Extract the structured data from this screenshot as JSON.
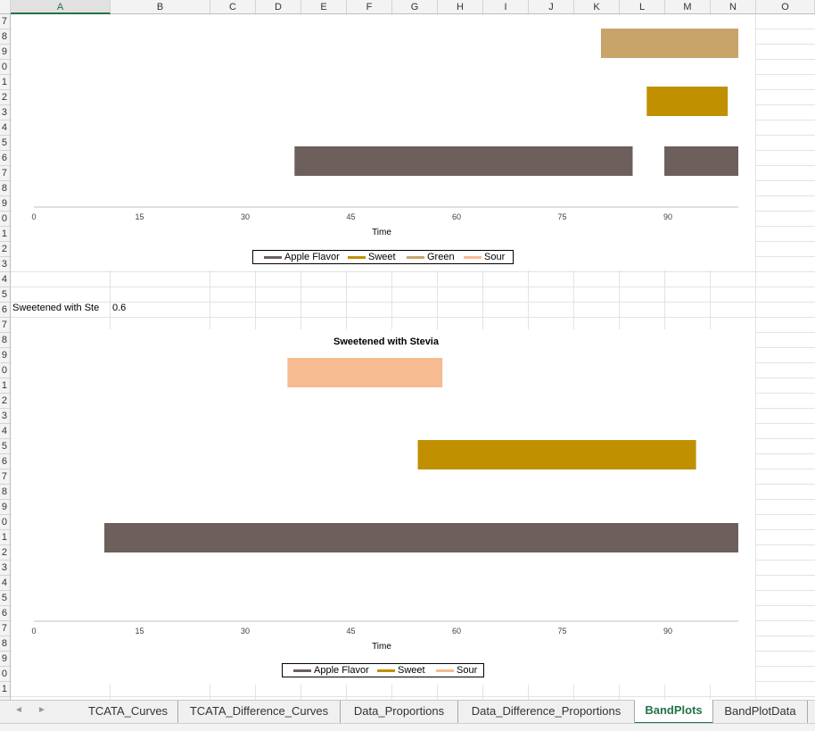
{
  "sheet": {
    "columns": [
      "A",
      "B",
      "C",
      "D",
      "E",
      "F",
      "G",
      "H",
      "I",
      "J",
      "K",
      "L",
      "M",
      "N",
      "O"
    ],
    "selected_column": "A",
    "row_labels": [
      "7",
      "8",
      "9",
      "0",
      "1",
      "2",
      "3",
      "4",
      "5",
      "6",
      "7",
      "8",
      "9",
      "0",
      "1",
      "2",
      "3",
      "4",
      "5",
      "6",
      "7",
      "8",
      "9",
      "0",
      "1",
      "2",
      "3",
      "4",
      "5",
      "6",
      "7",
      "8",
      "9",
      "0",
      "1",
      "2",
      "3",
      "4",
      "5",
      "6",
      "7",
      "8",
      "9",
      "0",
      "1",
      "2",
      "3",
      "4",
      "5",
      "6",
      "7",
      "8",
      "9",
      "0",
      "1",
      "2",
      "3",
      "4",
      "5",
      "6",
      "7",
      "8",
      "9",
      "0",
      "1",
      "2",
      "3",
      "4"
    ],
    "cells": {
      "a_label": "Sweetened with Ste",
      "b_value": "0.6"
    }
  },
  "tabs": [
    {
      "label": "TCATA_Curves",
      "active": false
    },
    {
      "label": "TCATA_Difference_Curves",
      "active": false
    },
    {
      "label": "Data_Proportions",
      "active": false
    },
    {
      "label": "Data_Difference_Proportions",
      "active": false
    },
    {
      "label": "BandPlots",
      "active": true
    },
    {
      "label": "BandPlotData",
      "active": false
    }
  ],
  "nav": {
    "prev": "◄",
    "next": "►"
  },
  "colors": {
    "apple_flavor": "#6d5f5c",
    "sweet": "#c09000",
    "green": "#c8a46a",
    "sour": "#f6bb90",
    "tab_accent": "#217346"
  },
  "chart_data": [
    {
      "type": "bar",
      "subtype": "band",
      "title": "",
      "xlabel": "Time",
      "ylabel": "",
      "xlim": [
        0,
        100
      ],
      "xticks": [
        0,
        15,
        30,
        45,
        60,
        75,
        90
      ],
      "rows": [
        "Green",
        "Sweet",
        "Apple Flavor"
      ],
      "bands": [
        {
          "name": "Green",
          "start": 80.5,
          "end": 100,
          "color": "#c8a46a"
        },
        {
          "name": "Sweet",
          "start": 87,
          "end": 98.5,
          "color": "#c09000"
        },
        {
          "name": "Apple Flavor",
          "start": 37,
          "end": 85,
          "color": "#6d5f5c"
        },
        {
          "name": "Apple Flavor",
          "start": 89.5,
          "end": 100,
          "color": "#6d5f5c"
        }
      ],
      "legend": {
        "position": "bottom",
        "entries": [
          {
            "name": "Apple Flavor",
            "color": "#6d5f5c"
          },
          {
            "name": "Sweet",
            "color": "#c09000"
          },
          {
            "name": "Green",
            "color": "#c8a46a"
          },
          {
            "name": "Sour",
            "color": "#f6bb90"
          }
        ]
      }
    },
    {
      "type": "bar",
      "subtype": "band",
      "title": "Sweetened with Stevia",
      "xlabel": "Time",
      "ylabel": "",
      "xlim": [
        0,
        100
      ],
      "xticks": [
        0,
        15,
        30,
        45,
        60,
        75,
        90
      ],
      "rows": [
        "Sour",
        "Sweet",
        "Apple Flavor"
      ],
      "bands": [
        {
          "name": "Sour",
          "start": 36,
          "end": 58,
          "color": "#f6bb90"
        },
        {
          "name": "Sweet",
          "start": 54.5,
          "end": 94,
          "color": "#c09000"
        },
        {
          "name": "Apple Flavor",
          "start": 10,
          "end": 100,
          "color": "#6d5f5c"
        }
      ],
      "legend": {
        "position": "bottom",
        "entries": [
          {
            "name": "Apple Flavor",
            "color": "#6d5f5c"
          },
          {
            "name": "Sweet",
            "color": "#c09000"
          },
          {
            "name": "Sour",
            "color": "#f6bb90"
          }
        ]
      }
    }
  ]
}
